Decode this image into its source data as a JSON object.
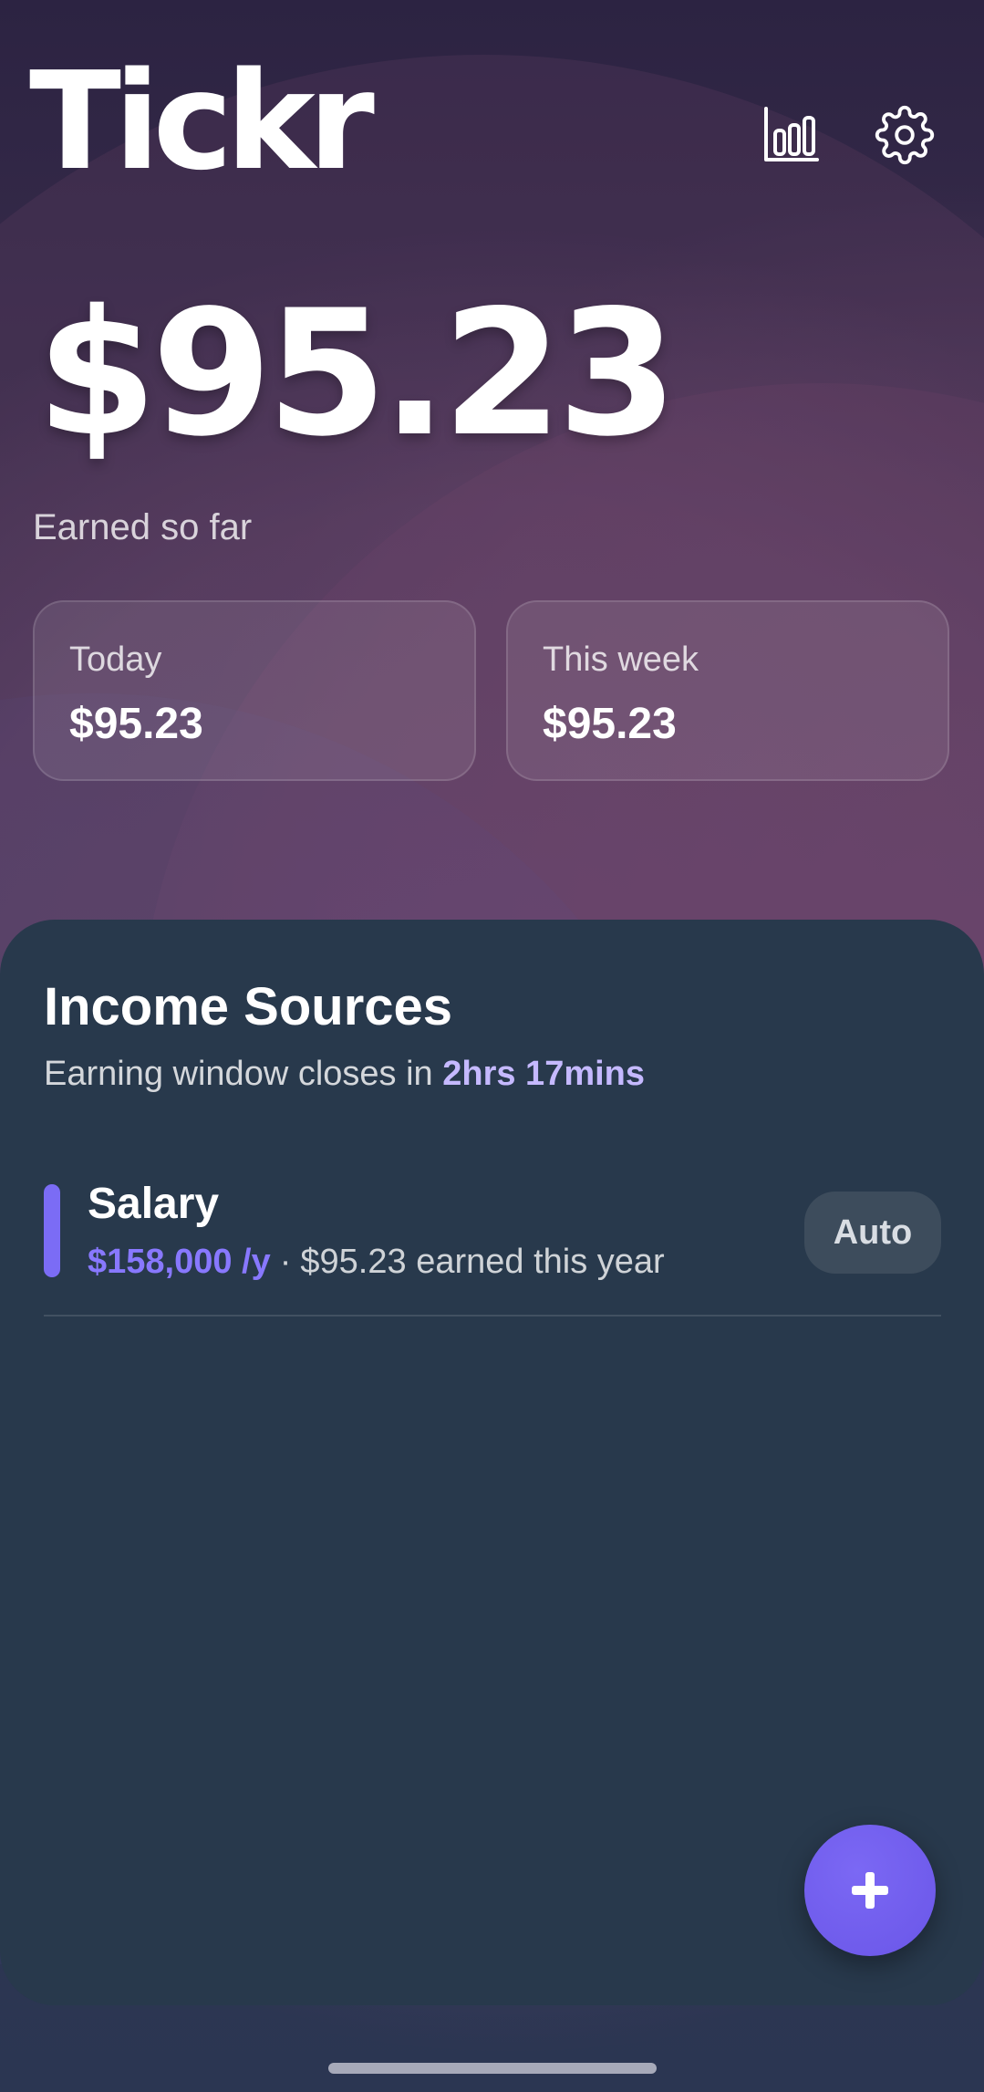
{
  "app": {
    "logo_text": "Tickr"
  },
  "header": {
    "icons": [
      "bar-chart-icon",
      "gear-icon"
    ]
  },
  "summary": {
    "total_amount": "$95.23",
    "total_label": "Earned so far",
    "cards": [
      {
        "label": "Today",
        "value": "$95.23"
      },
      {
        "label": "This week",
        "value": "$95.23"
      }
    ]
  },
  "income_sources": {
    "title": "Income Sources",
    "subtitle_prefix": "Earning window closes in ",
    "subtitle_time": "2hrs 17mins",
    "items": [
      {
        "name": "Salary",
        "rate": "$158,000 /y",
        "separator": "·",
        "earned_text": "$95.23 earned this year",
        "badge": "Auto",
        "accent_color": "#7b6cf5"
      }
    ]
  },
  "fab": {
    "icon": "plus-icon"
  },
  "colors": {
    "accent": "#7b6cf5",
    "highlight": "#c5b9ff",
    "sheet": "#28394c"
  }
}
